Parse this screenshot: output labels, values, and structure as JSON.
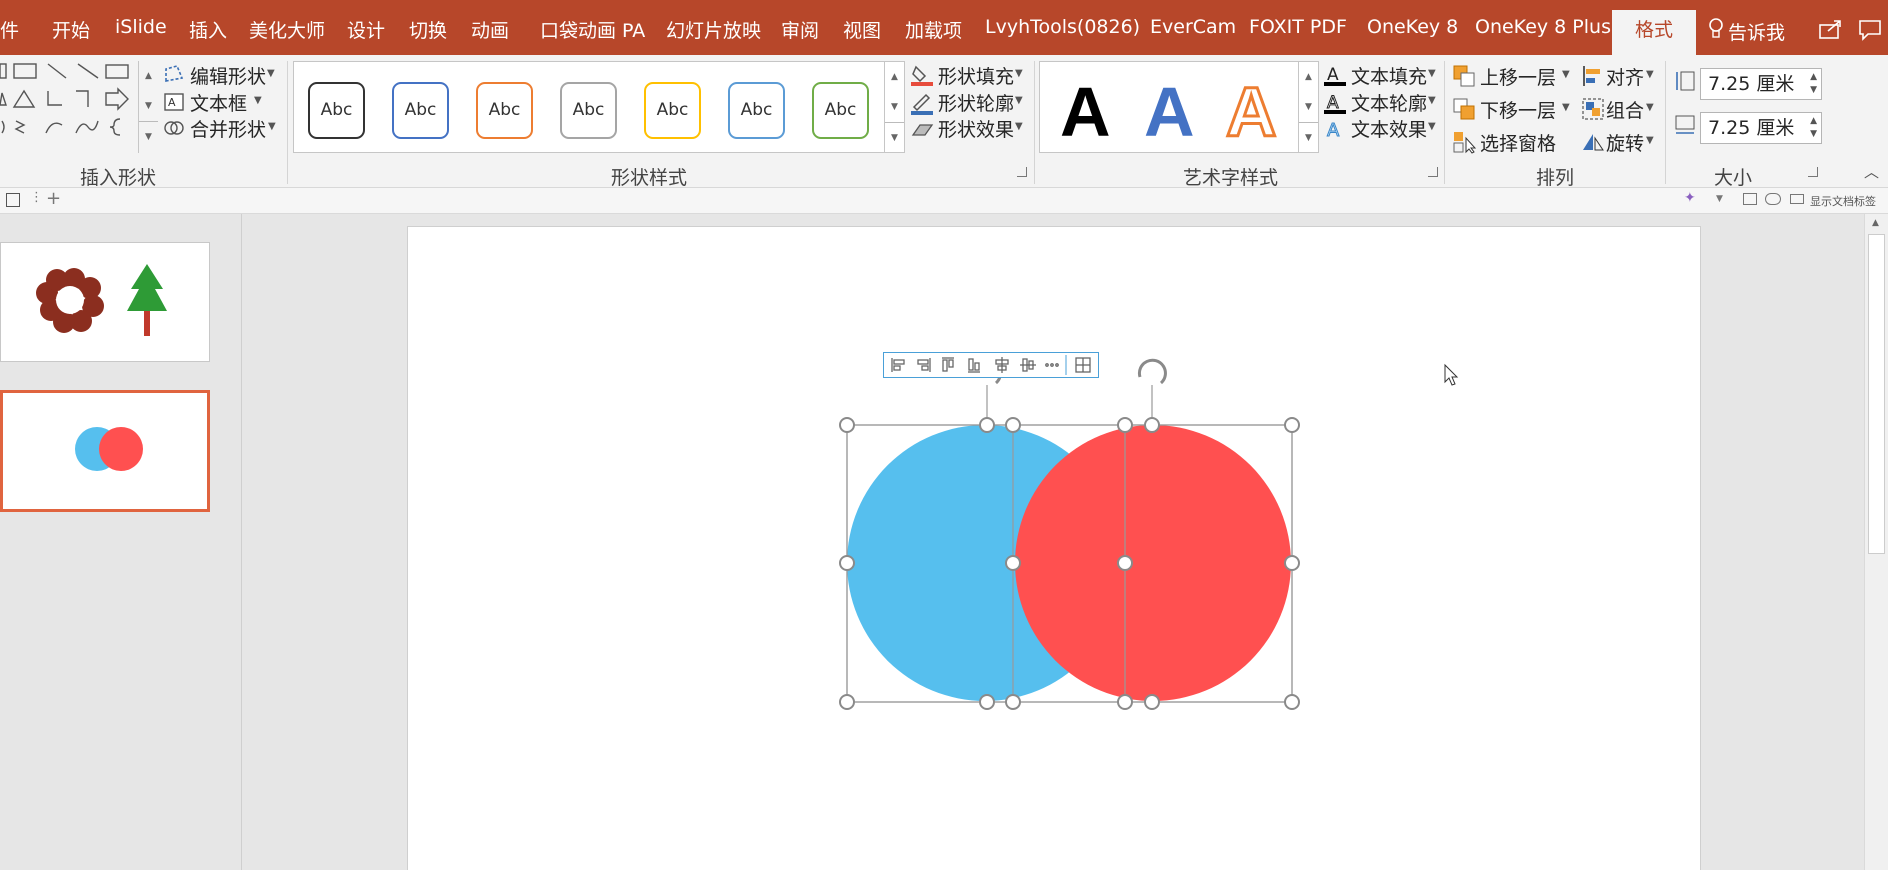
{
  "ribbon_tabs": [
    {
      "label": "件"
    },
    {
      "label": "开始"
    },
    {
      "label": "iSlide"
    },
    {
      "label": "插入"
    },
    {
      "label": "美化大师"
    },
    {
      "label": "设计"
    },
    {
      "label": "切换"
    },
    {
      "label": "动画"
    },
    {
      "label": "口袋动画 PA"
    },
    {
      "label": "幻灯片放映"
    },
    {
      "label": "审阅"
    },
    {
      "label": "视图"
    },
    {
      "label": "加载项"
    },
    {
      "label": "LvyhTools(0826)"
    },
    {
      "label": "EverCam"
    },
    {
      "label": "FOXIT PDF"
    },
    {
      "label": "OneKey 8"
    },
    {
      "label": "OneKey 8 Plus"
    }
  ],
  "active_tab": "格式",
  "tell_me": "告诉我",
  "insert_shapes": {
    "edit_shape": "编辑形状",
    "text_box": "文本框",
    "merge_shapes": "合并形状",
    "group_label": "插入形状"
  },
  "shape_styles": {
    "presets": [
      {
        "text": "Abc",
        "color": "#262626"
      },
      {
        "text": "Abc",
        "color": "#4472c4"
      },
      {
        "text": "Abc",
        "color": "#ed7d31"
      },
      {
        "text": "Abc",
        "color": "#a5a5a5"
      },
      {
        "text": "Abc",
        "color": "#ffc000"
      },
      {
        "text": "Abc",
        "color": "#5b9bd5"
      },
      {
        "text": "Abc",
        "color": "#70ad47"
      }
    ],
    "fill": "形状填充",
    "outline": "形状轮廓",
    "effect": "形状效果",
    "group_label": "形状样式"
  },
  "wordart": {
    "letters": [
      {
        "text": "A",
        "color": "#000000"
      },
      {
        "text": "A",
        "color": "#4472c4"
      },
      {
        "text": "A",
        "color": "#ed7d31"
      }
    ],
    "fill": "文本填充",
    "outline": "文本轮廓",
    "effect": "文本效果",
    "group_label": "艺术字样式"
  },
  "arrange": {
    "bring_forward": "上移一层",
    "send_backward": "下移一层",
    "selection_pane": "选择窗格",
    "align": "对齐",
    "group": "组合",
    "rotate": "旋转",
    "group_label": "排列"
  },
  "size": {
    "height": "7.25 厘米",
    "width": "7.25 厘米",
    "group_label": "大小"
  },
  "quick_access": {
    "show_tags": "显示文档标签"
  },
  "colors": {
    "accent": "#b7472a",
    "blue_circle": "#56bfee",
    "red_circle": "#ff5050",
    "flower": "#8b2e1f",
    "tree": "#2e9b36",
    "trunk": "#c0392b"
  }
}
